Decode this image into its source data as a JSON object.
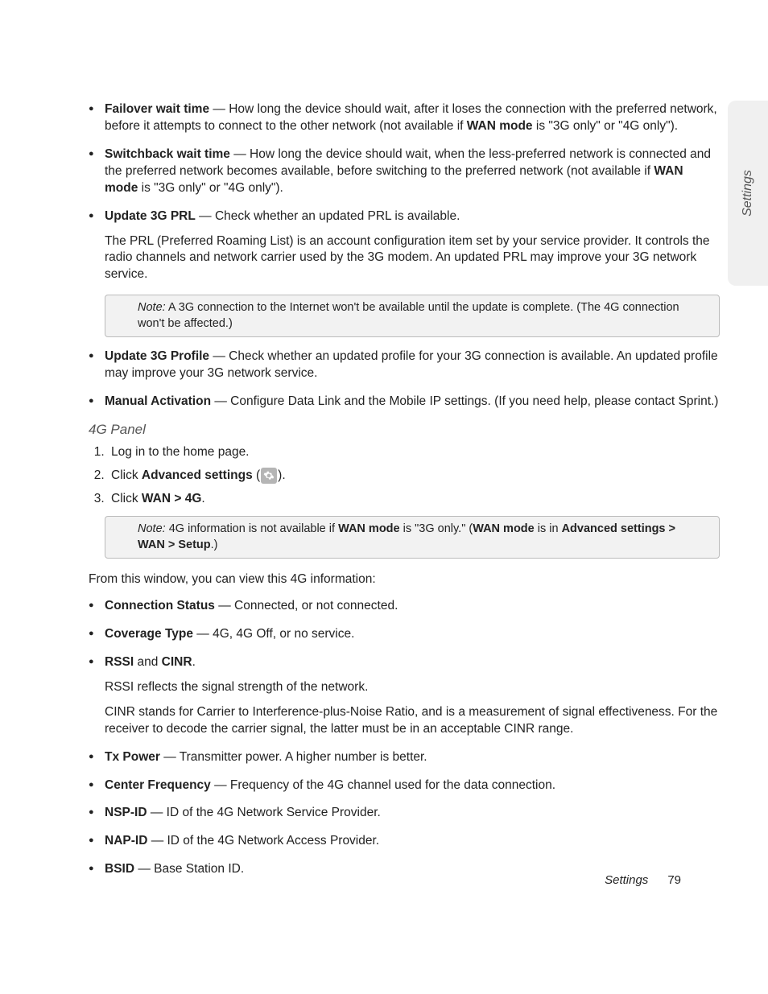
{
  "sideTab": "Settings",
  "bulletsA": {
    "failover": {
      "label": "Failover wait time",
      "t1": " — How long the device should wait, after it loses the connection with the preferred network, before it attempts to connect to the other network (not available if ",
      "b1": "WAN mode",
      "t2": " is \"3G only\" or \"4G only\")."
    },
    "switchback": {
      "label": "Switchback wait time",
      "t1": " — How long the device should wait, when the less-preferred network is connected and the preferred network becomes available, before switching to the preferred network (not available if ",
      "b1": "WAN mode",
      "t2": " is \"3G only\" or \"4G only\")."
    },
    "updatePRL": {
      "label": "Update 3G PRL",
      "t1": " — Check whether an updated PRL is available.",
      "p2": "The PRL (Preferred Roaming List) is an account configuration item set by your service provider. It controls the radio channels and network carrier used by the 3G modem. An updated PRL may improve your 3G network service."
    }
  },
  "note1": {
    "label": "Note:",
    "text": "  A 3G connection to the Internet won't be available until the update is complete. (The 4G connection won't be affected.)"
  },
  "bulletsB": {
    "updateProfile": {
      "label": "Update 3G Profile",
      "t1": " — Check whether an updated profile for your 3G connection is available. An updated profile may improve your 3G network service."
    },
    "manual": {
      "label": "Manual Activation",
      "t1": " — Configure Data Link and the Mobile IP settings. (If you need help, please contact Sprint.)"
    }
  },
  "sectionHeading": "4G Panel",
  "steps": {
    "s1": "Log in to the home page.",
    "s2a": "Click ",
    "s2b": "Advanced settings",
    "s2c": " (",
    "s2d": ").",
    "s3a": "Click ",
    "s3b": "WAN > 4G",
    "s3c": "."
  },
  "note2": {
    "label": "Note:",
    "t1": "  4G information is not available if ",
    "b1": "WAN mode",
    "t2": " is \"3G only.\" (",
    "b2": "WAN mode",
    "t3": " is in ",
    "b3": "Advanced settings > WAN > Setup",
    "t4": ".)"
  },
  "intro": "From this window, you can view this 4G information:",
  "bulletsC": {
    "conn": {
      "label": "Connection Status",
      "t1": " — Connected, or not connected."
    },
    "cov": {
      "label": "Coverage Type",
      "t1": " — 4G, 4G Off, or no service."
    },
    "rssi": {
      "label": "RSSI",
      "mid": " and ",
      "label2": "CINR",
      "tail": ".",
      "p2": "RSSI reflects the signal strength of the network.",
      "p3": "CINR stands for Carrier to Interference-plus-Noise Ratio, and is a measurement of signal effectiveness. For the receiver to decode the carrier signal, the latter must be in an acceptable CINR range."
    },
    "tx": {
      "label": "Tx Power",
      "t1": " — Transmitter power. A higher number is better."
    },
    "cf": {
      "label": "Center Frequency",
      "t1": " — Frequency of the 4G channel used for the data connection."
    },
    "nsp": {
      "label": "NSP-ID",
      "t1": " — ID of the 4G Network Service Provider."
    },
    "nap": {
      "label": "NAP-ID",
      "t1": " — ID of the 4G Network Access Provider."
    },
    "bsid": {
      "label": "BSID",
      "t1": " — Base Station ID."
    }
  },
  "footer": {
    "name": "Settings",
    "page": "79"
  }
}
